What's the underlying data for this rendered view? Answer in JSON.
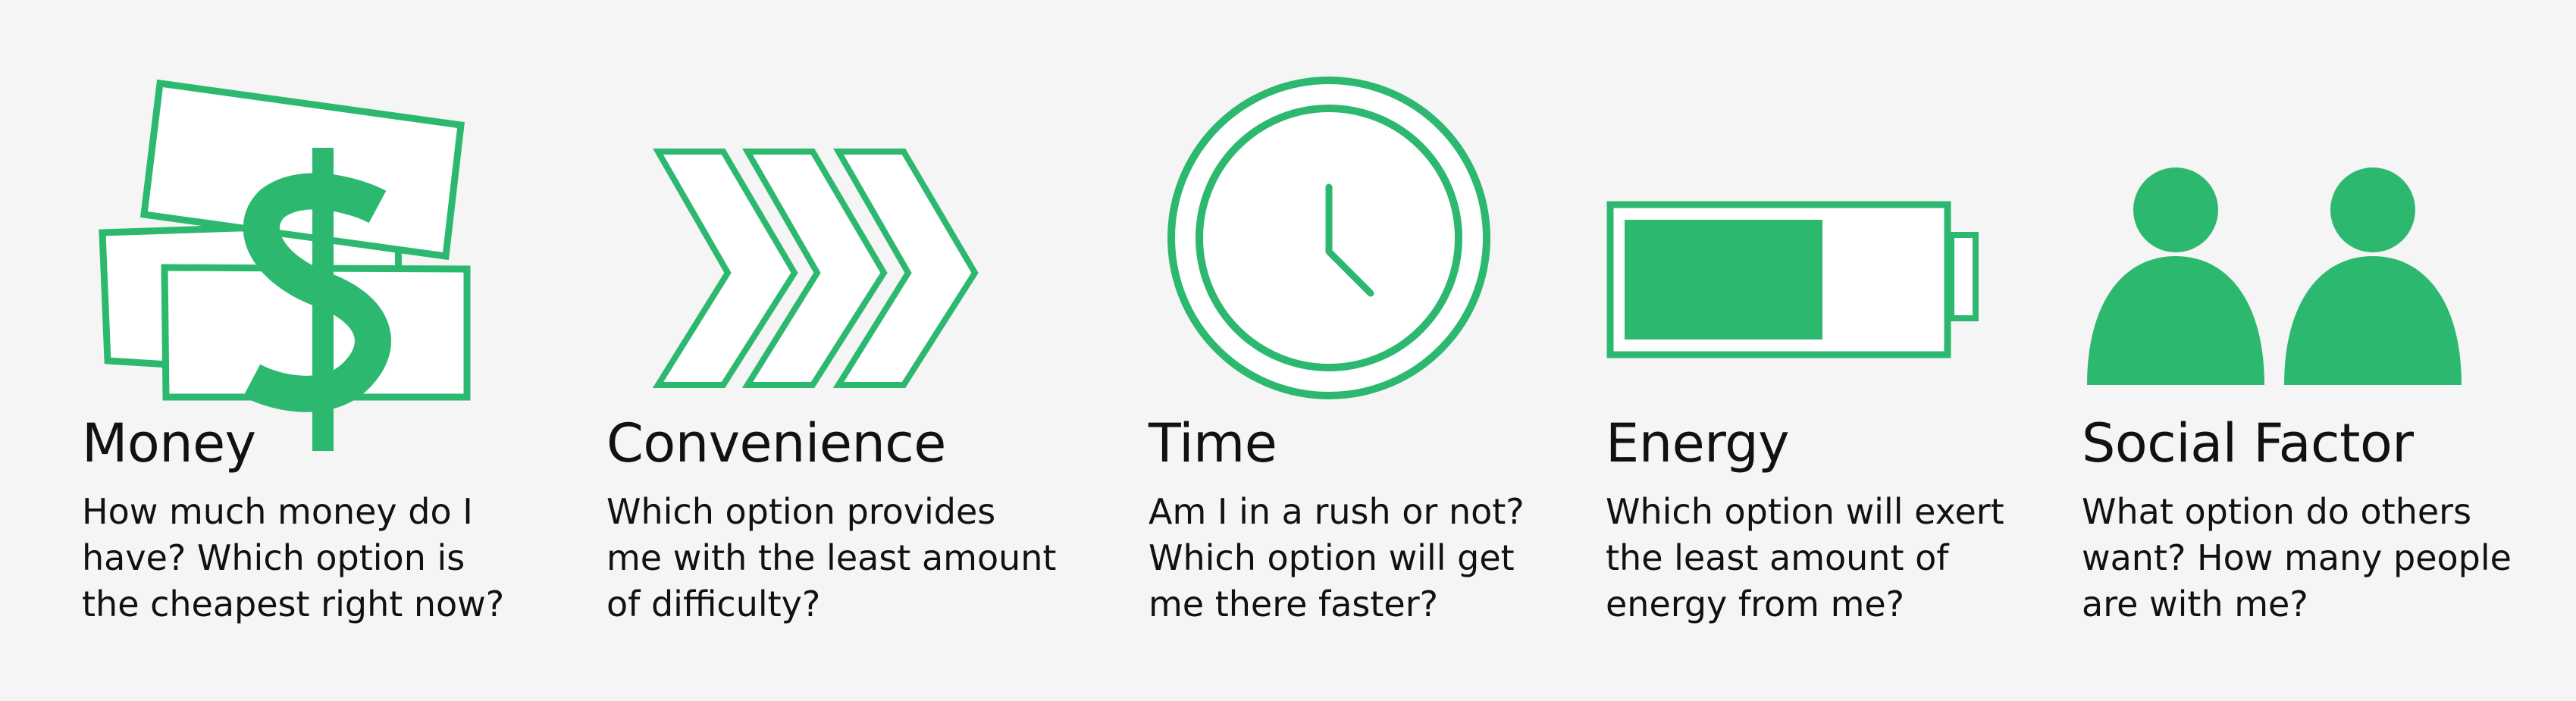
{
  "colors": {
    "accent": "#2db870",
    "background": "#f5f5f5",
    "text": "#111111",
    "icon_fill": "#ffffff"
  },
  "factors": [
    {
      "icon": "money-icon",
      "title": "Money",
      "lines": [
        "How much money do I",
        "have? Which option is",
        "the cheapest right now?"
      ]
    },
    {
      "icon": "chevrons-icon",
      "title": "Convenience",
      "lines": [
        "Which option provides",
        "me with the least amount",
        "of difficulty?"
      ]
    },
    {
      "icon": "clock-icon",
      "title": "Time",
      "lines": [
        "Am I in a rush or not?",
        "Which option will get",
        "me there faster?"
      ]
    },
    {
      "icon": "battery-icon",
      "title": "Energy",
      "lines": [
        "Which option will exert",
        "the least amount of",
        "energy from me?"
      ]
    },
    {
      "icon": "people-icon",
      "title": "Social Factor",
      "lines": [
        "What option do others",
        "want? How many people",
        "are with me?"
      ]
    }
  ],
  "battery_level": 0.64
}
